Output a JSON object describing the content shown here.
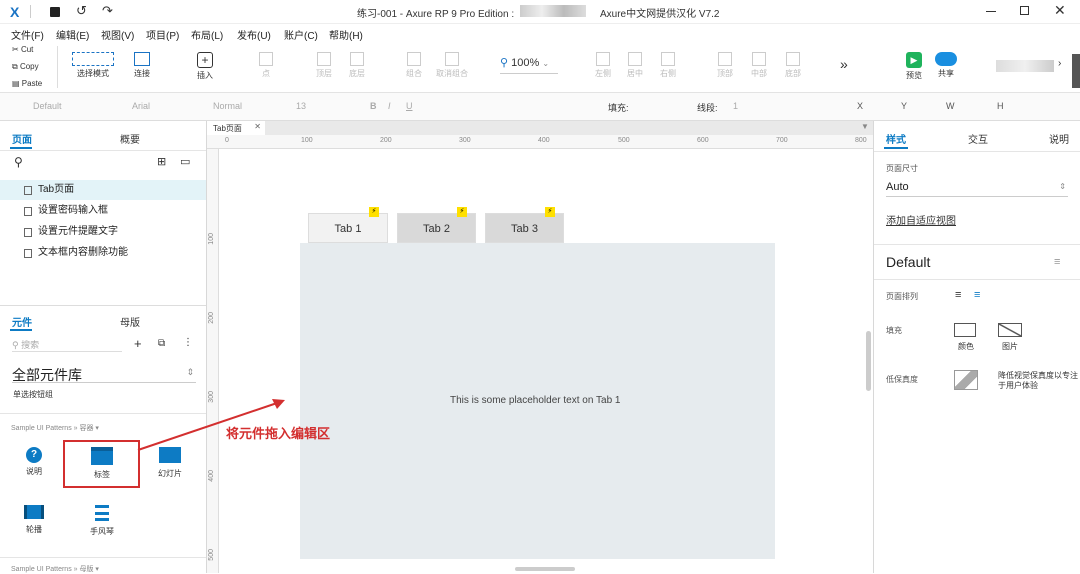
{
  "titlebar": {
    "title": "练习-001 - Axure RP 9 Pro Edition :",
    "edition": "Axure中文网提供汉化 V7.2"
  },
  "menu": [
    "文件(F)",
    "编辑(E)",
    "视图(V)",
    "项目(P)",
    "布局(L)",
    "发布(U)",
    "账户(C)",
    "帮助(H)"
  ],
  "clipboard": {
    "cut": "Cut",
    "copy": "Copy",
    "paste": "Paste"
  },
  "toolbar": {
    "select_mode": "选择模式",
    "connect": "连接",
    "insert": "插入",
    "point": "点",
    "top_layer": "顶层",
    "bottom_layer": "底层",
    "group": "组合",
    "ungroup": "取消组合",
    "zoom": "100%",
    "left": "左侧",
    "center": "居中",
    "right": "右侧",
    "top": "顶部",
    "middle": "中部",
    "bottom": "底部",
    "more": "»",
    "preview": "预览",
    "share": "共享"
  },
  "format": {
    "style": "Default",
    "font": "Arial",
    "weight": "Normal",
    "size": "13",
    "fill_label": "填充:",
    "line_label": "线段:",
    "line_val": "1",
    "x": "X",
    "y": "Y",
    "w": "W",
    "h": "H"
  },
  "pages_panel": {
    "tab_pages": "页面",
    "tab_outline": "概要",
    "pages": [
      "Tab页面",
      "设置密码输入框",
      "设置元件提醒文字",
      "文本框内容删除功能"
    ]
  },
  "library_panel": {
    "tab_widgets": "元件",
    "tab_masters": "母版",
    "search_placeholder": "搜索",
    "library_name": "全部元件库",
    "subitem": "单选按钮组",
    "section1": "Sample UI Patterns » 容器 ▾",
    "section2": "Sample UI Patterns » 母版 ▾",
    "widgets": [
      "说明",
      "标签",
      "幻灯片",
      "轮播",
      "手风琴"
    ]
  },
  "canvas": {
    "tab_name": "Tab页面",
    "ruler_h": [
      "0",
      "100",
      "200",
      "300",
      "400",
      "500",
      "600",
      "700",
      "800"
    ],
    "ruler_v": [
      "100",
      "200",
      "300",
      "400",
      "500"
    ],
    "tabs": [
      "Tab 1",
      "Tab 2",
      "Tab 3"
    ],
    "bolt": "⚡",
    "placeholder": "This is some placeholder text on Tab 1",
    "annotation": "将元件拖入编辑区"
  },
  "right_panel": {
    "tab_style": "样式",
    "tab_interact": "交互",
    "tab_notes": "说明",
    "page_size_label": "页面尺寸",
    "page_size_value": "Auto",
    "adaptive": "添加自适应视图",
    "style_name": "Default",
    "page_align": "页面排列",
    "fill": "填充",
    "fill_color": "颜色",
    "fill_image": "图片",
    "low_fidelity": "低保真度",
    "low_fidelity_desc": "降低视觉保真度以专注于用户体验"
  },
  "colors": {
    "accent": "#0d7bc4",
    "annotation": "#d32f2f",
    "panel_bg": "#e6ebee"
  }
}
